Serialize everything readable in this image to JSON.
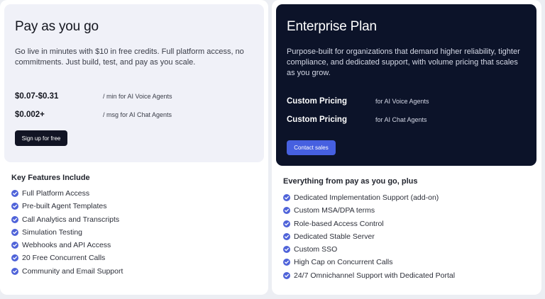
{
  "payg": {
    "title": "Pay as you go",
    "description": "Go live in minutes with $10 in free credits. Full platform access, no commitments. Just build, test, and pay as you scale.",
    "prices": [
      {
        "amount": "$0.07-$0.31",
        "unit": "/ min for AI Voice Agents"
      },
      {
        "amount": "$0.002+",
        "unit": "/ msg for AI Chat Agents"
      }
    ],
    "button_label": "Sign up for free",
    "features_heading": "Key Features Include",
    "features": [
      "Full Platform Access",
      "Pre-built Agent Templates",
      "Call Analytics and Transcripts",
      "Simulation Testing",
      "Webhooks and API Access",
      "20 Free Concurrent Calls",
      "Community and Email Support"
    ]
  },
  "enterprise": {
    "title": "Enterprise Plan",
    "description": "Purpose-built for organizations that demand higher reliability, tighter compliance, and dedicated support, with volume pricing that scales as you grow.",
    "prices": [
      {
        "amount": "Custom Pricing",
        "unit": "for AI Voice Agents"
      },
      {
        "amount": "Custom Pricing",
        "unit": "for AI Chat Agents"
      }
    ],
    "button_label": "Contact sales",
    "features_heading": "Everything from pay as you go, plus",
    "features": [
      "Dedicated Implementation Support (add-on)",
      "Custom MSA/DPA terms",
      "Role-based Access Control",
      "Dedicated Stable Server",
      "Custom SSO",
      "High Cap on Concurrent Calls",
      "24/7 Omnichannel Support with Dedicated Portal"
    ]
  },
  "colors": {
    "check_accent": "#4f63d9",
    "enterprise_bg": "#0c1329",
    "payg_bg": "#f0f1f8",
    "contact_button": "#4660e0",
    "signup_button": "#111424"
  },
  "icons": {
    "feature_bullet": "check-circle-icon"
  }
}
